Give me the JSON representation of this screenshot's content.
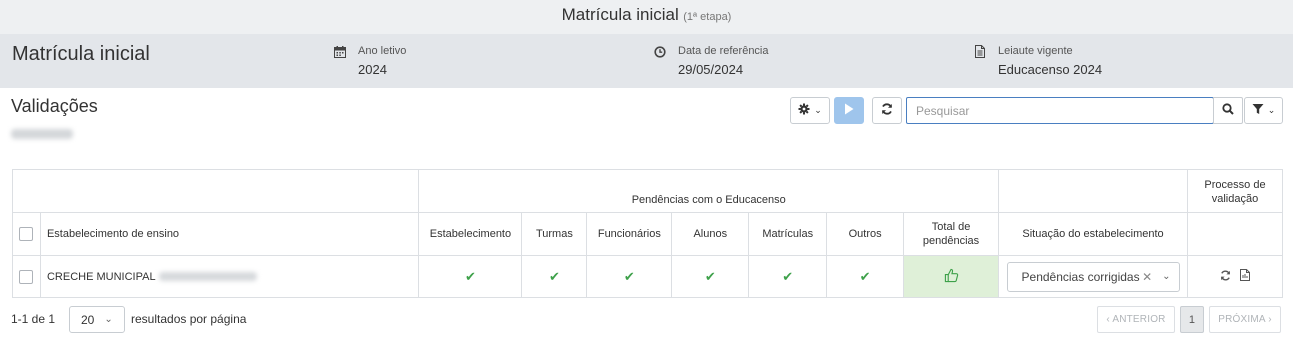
{
  "topbar": {
    "title": "Matrícula inicial",
    "subtitle": "(1ª etapa)"
  },
  "info": {
    "main_title": "Matrícula inicial",
    "ano_letivo": {
      "label": "Ano letivo",
      "value": "2024",
      "icon": "calendar-icon"
    },
    "data_referencia": {
      "label": "Data de referência",
      "value": "29/05/2024",
      "icon": "clock-icon"
    },
    "leiaute": {
      "label": "Leiaute vigente",
      "value": "Educacenso 2024",
      "icon": "document-icon"
    }
  },
  "section": {
    "title": "Validações"
  },
  "toolbar": {
    "settings_icon": "gear-icon",
    "play_icon": "play-icon",
    "refresh_icon": "refresh-icon",
    "search_placeholder": "Pesquisar",
    "search_icon": "search-icon",
    "filter_icon": "filter-icon"
  },
  "table": {
    "group_header": "Pendências com o Educacenso",
    "process_header": "Processo de validação",
    "columns": {
      "establishment": "Estabelecimento de ensino",
      "estabelecimento": "Estabelecimento",
      "turmas": "Turmas",
      "funcionarios": "Funcionários",
      "alunos": "Alunos",
      "matriculas": "Matrículas",
      "outros": "Outros",
      "total": "Total de pendências",
      "situacao": "Situação do estabelecimento"
    },
    "rows": [
      {
        "name": "CRECHE MUNICIPAL",
        "status": "Pendências corrigidas",
        "total_icon": "thumbs-up-icon"
      }
    ]
  },
  "footer": {
    "count": "1-1 de 1",
    "page_size": "20",
    "per_page_label": "resultados por página",
    "prev": "‹ ANTERIOR",
    "current_page": "1",
    "next": "PRÓXIMA ›"
  },
  "colors": {
    "accent": "#4a7fc1",
    "success": "#3ea14a",
    "success_bg": "#dff0d8",
    "play": "#9fc5ec"
  }
}
